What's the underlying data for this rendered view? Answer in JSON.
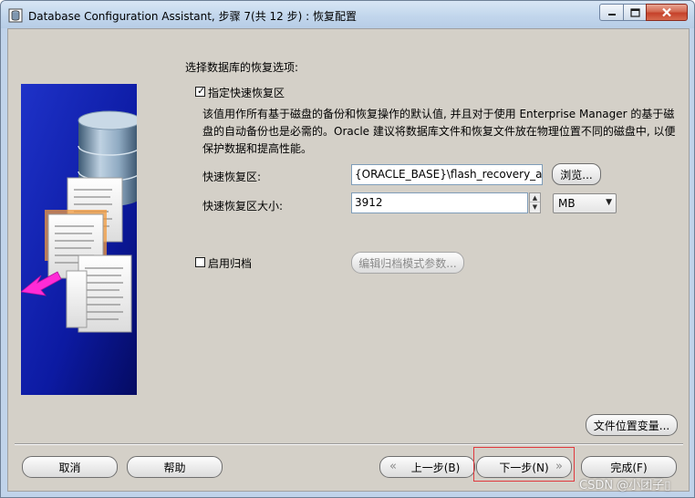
{
  "window": {
    "title": "Database Configuration Assistant, 步骤 7(共 12 步) : 恢复配置",
    "controls": [
      "minimize",
      "maximize",
      "close"
    ]
  },
  "icons": {
    "app": "database-icon",
    "minimize": "minimize-icon",
    "maximize": "maximize-icon",
    "close": "close-icon",
    "back": "chevron-left-icon",
    "next": "chevron-right-icon"
  },
  "recovery": {
    "heading": "选择数据库的恢复选项:",
    "flash_checkbox_label": "指定快速恢复区",
    "flash_checked": true,
    "description": "该值用作所有基于磁盘的备份和恢复操作的默认值, 并且对于使用 Enterprise Manager 的基于磁盘的自动备份也是必需的。Oracle 建议将数据库文件和恢复文件放在物理位置不同的磁盘中, 以便保护数据和提高性能。",
    "area_label": "快速恢复区:",
    "area_value": "{ORACLE_BASE}\\flash_recovery_area",
    "browse_button": "浏览...",
    "size_label": "快速恢复区大小:",
    "size_value": "3912",
    "size_unit": "MB",
    "archive_checkbox_label": "启用归档",
    "archive_checked": false,
    "archive_params_button": "编辑归档模式参数..."
  },
  "buttons": {
    "file_location_vars": "文件位置变量...",
    "cancel": "取消",
    "help": "帮助",
    "back": "上一步(B)",
    "next": "下一步(N)",
    "finish": "完成(F)"
  },
  "watermark": "CSDN @小团子▯",
  "colors": {
    "dialog_bg": "#d4d0c8",
    "illustration_blue": "#0a1ea8",
    "highlight_red": "#e0393e",
    "arrow_magenta": "#ff2bd6"
  }
}
